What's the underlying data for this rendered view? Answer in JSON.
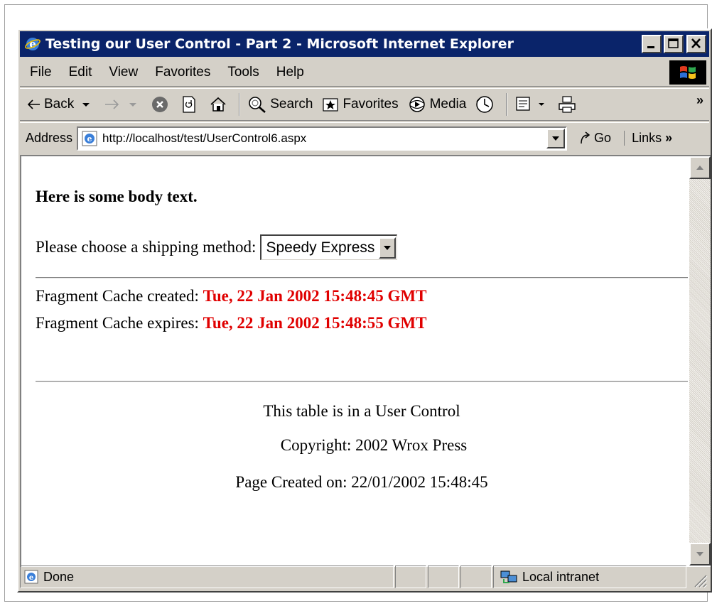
{
  "window": {
    "title": "Testing our User Control - Part 2 - Microsoft Internet Explorer"
  },
  "menu": {
    "items": [
      "File",
      "Edit",
      "View",
      "Favorites",
      "Tools",
      "Help"
    ]
  },
  "toolbar": {
    "back_label": "Back",
    "search_label": "Search",
    "favorites_label": "Favorites",
    "media_label": "Media",
    "more_label": "»"
  },
  "address": {
    "label": "Address",
    "url": "http://localhost/test/UserControl6.aspx",
    "go_label": "Go",
    "links_label": "Links",
    "links_more": "»"
  },
  "page": {
    "body_text": "Here is some body text.",
    "shipping_prompt": "Please choose a shipping method:",
    "shipping_selected": "Speedy Express",
    "cache_created_label": "Fragment Cache created:",
    "cache_created_value": "Tue, 22 Jan 2002 15:48:45 GMT",
    "cache_expires_label": "Fragment Cache expires:",
    "cache_expires_value": "Tue, 22 Jan 2002 15:48:55 GMT",
    "control_note": "This table is in a User Control",
    "copyright": "Copyright: 2002 Wrox Press",
    "page_created": "Page Created on: 22/01/2002 15:48:45"
  },
  "status": {
    "text": "Done",
    "zone": "Local intranet"
  },
  "colors": {
    "titlebar": "#0a246a",
    "chrome": "#d4d0c8",
    "timestamp": "#e00000"
  }
}
